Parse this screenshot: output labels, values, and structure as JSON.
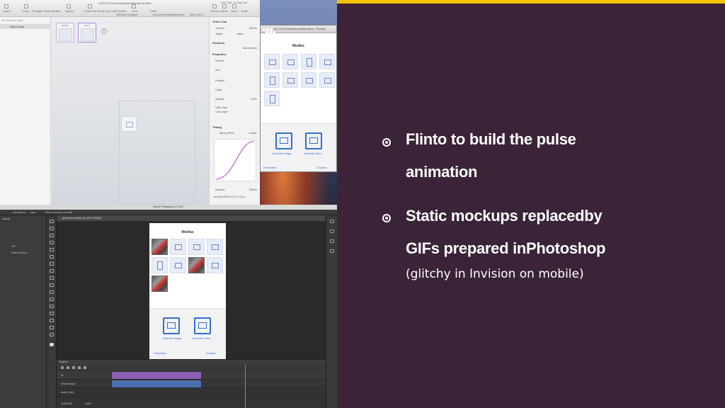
{
  "slide": {
    "bullets": [
      {
        "line1": "Flinto to build the pulse",
        "line2": "animation"
      },
      {
        "line1": "Static mockups replacedby",
        "line2": "GIFs prepared inPhotoshop",
        "note": "(glitchy in Invision on mobile)"
      }
    ]
  },
  "colors": {
    "background": "#3b2437",
    "accent_line": "#f2c200",
    "text": "#ffffff",
    "ios_blue": "#2f6fd0"
  },
  "flinto": {
    "title": "2017-09-19-ios-tabs-workflow-demo.flinto",
    "toolbar_labels": [
      "Layers",
      "Group",
      "Prototype",
      "Show Variable",
      "Symbol",
      "Create Link",
      "Break Link",
      "Lock Screens",
      "Zoom",
      "Grids",
      "Behavior Designer",
      "components\\medias\\preview",
      "Save & Exit",
      "Preview",
      "Viewer",
      "Share",
      "Invite",
      "Free Trial: 14 Days Left"
    ],
    "sidebar_header": "No Selected Layer",
    "sidebar_item": "New Group",
    "screen_names": [
      "Medias",
      "Button"
    ],
    "inspector": {
      "timer_link": "Timer Link",
      "timeout_label": "Timeout",
      "timeout_value": "500ms",
      "target_label": "Target",
      "target_value": "Initial",
      "gestures": "Gestures",
      "add_gesture": "Add Gesture",
      "properties": "Properties",
      "position": "Position",
      "size": "Size",
      "rotation": "Rotation",
      "origin": "Origin",
      "opacity": "Opacity",
      "opacity_value": "100%",
      "hide_layer": "Hide Layer",
      "lock_layer": "Lock Layer",
      "timing": "Timing",
      "spring": "Spring (RK4)",
      "classic": "Classic",
      "duration": "Duration",
      "duration_value": "600ms",
      "bezier": "bezier(0.550,0.013,0.775,1)"
    }
  },
  "preview": {
    "window_title": "2017-09-19-ios-tabs-workflow demo - Preview",
    "heading": "Medias",
    "button_image": "Nouvelle Image",
    "button_video": "Nouvelle Video",
    "nav_prev": "Précédent",
    "nav_next": "Suivant"
  },
  "photoshop": {
    "app_title": "Adobe Photoshop CC 2017",
    "options": [
      "Auto-Select:",
      "Layer",
      "Show Transform Controls"
    ],
    "layers_header": "Layers",
    "layers": [
      "GIF",
      "Video Group 1"
    ],
    "doc_tab": "gif-horizon-medias @ 100% (RGB/8)",
    "doc_heading": "Medias",
    "button_image": "Nouvelle Image",
    "button_video": "Nouvelle Video",
    "nav_prev": "Précédent",
    "nav_next": "Suivant",
    "timeline_header": "Timeline",
    "timeline_tracks": [
      "01",
      "Video Group 1",
      "Audio Track"
    ],
    "timeline_zoom": "100%",
    "timecode": "0:00:00:00"
  }
}
